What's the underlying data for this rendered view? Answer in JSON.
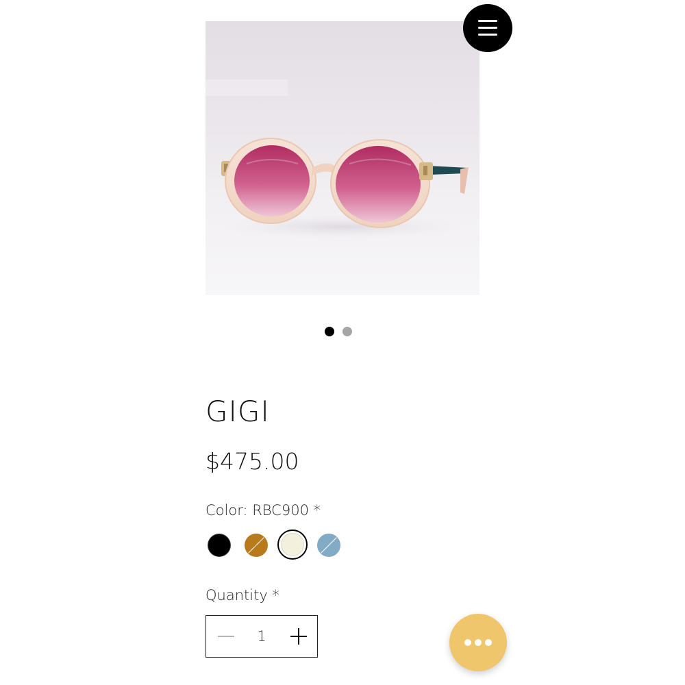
{
  "header": {
    "menu_icon": "hamburger-menu-icon"
  },
  "gallery": {
    "image_subject": "sunglasses",
    "slide_count": 2,
    "active_slide": 1,
    "colors": {
      "lens": "#c44a7c",
      "frame": "#f3d7c4",
      "temple": "#1f4a52"
    }
  },
  "product": {
    "title": "GIGI",
    "price": "$475.00",
    "color": {
      "label": "Color: RBC900",
      "required_mark": " *",
      "options": [
        {
          "name": "black",
          "hex": "#000000",
          "available": true,
          "selected": false
        },
        {
          "name": "amber",
          "hex": "#b97a1c",
          "available": false,
          "selected": false
        },
        {
          "name": "cream",
          "hex": "#f3f1de",
          "available": true,
          "selected": true
        },
        {
          "name": "blue",
          "hex": "#82abc6",
          "available": false,
          "selected": false
        }
      ]
    },
    "quantity": {
      "label": "Quantity",
      "required_mark": " *",
      "value": "1",
      "minus_icon": "minus-icon",
      "plus_icon": "plus-icon"
    }
  },
  "fab": {
    "icon": "more-horizontal-icon",
    "color": "#efc66c"
  }
}
